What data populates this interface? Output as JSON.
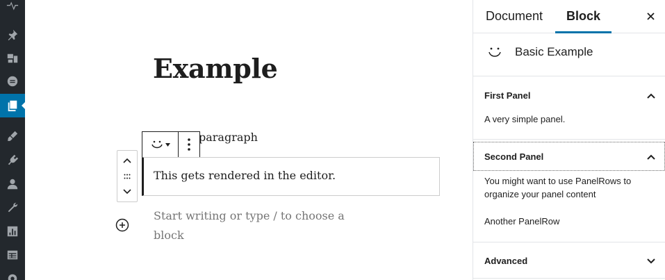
{
  "admin_menu": {
    "items": [
      {
        "icon": "activity-icon",
        "active": false
      },
      {
        "icon": "pin-icon",
        "active": false
      },
      {
        "icon": "media-icon",
        "active": false
      },
      {
        "icon": "comments-icon",
        "active": false
      },
      {
        "icon": "pages-icon",
        "active": true
      },
      {
        "icon": "appearance-icon",
        "active": false
      },
      {
        "icon": "plugins-icon",
        "active": false
      },
      {
        "icon": "users-icon",
        "active": false
      },
      {
        "icon": "tools-icon",
        "active": false
      },
      {
        "icon": "settings-icon",
        "active": false
      },
      {
        "icon": "table-icon",
        "active": false
      },
      {
        "icon": "gear-icon",
        "active": false
      }
    ]
  },
  "editor": {
    "post_title": "Example",
    "block_label": "paragraph",
    "block_content": "This gets rendered in the editor.",
    "placeholder": "Start writing or type / to choose a block"
  },
  "sidebar": {
    "tabs": {
      "document": "Document",
      "block": "Block"
    },
    "block_card": {
      "title": "Basic Example",
      "icon": "smiley-icon"
    },
    "panels": {
      "first": {
        "title": "First Panel",
        "body": "A very simple panel.",
        "open": true
      },
      "second": {
        "title": "Second Panel",
        "rows": [
          "You might want to use PanelRows to organize your panel content",
          "Another PanelRow"
        ],
        "open": true
      },
      "advanced": {
        "title": "Advanced",
        "open": false
      }
    }
  },
  "colors": {
    "admin_bg": "#23282d",
    "accent": "#0073aa",
    "active_menu": "#0073aa"
  }
}
